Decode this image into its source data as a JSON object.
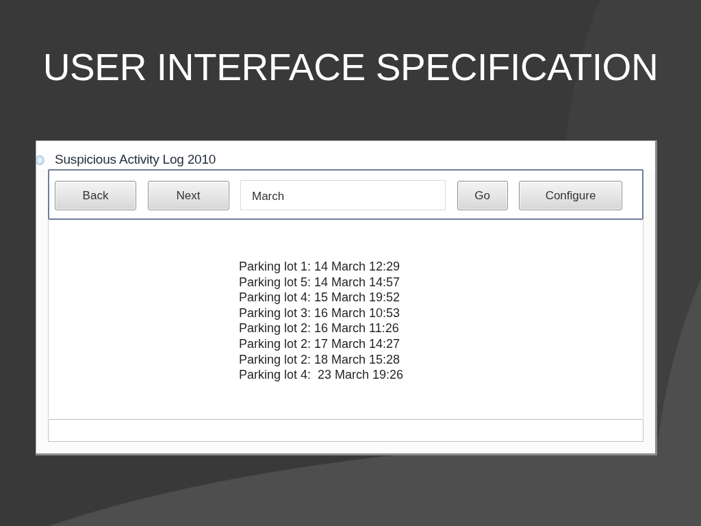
{
  "slide": {
    "title": "USER INTERFACE SPECIFICATION"
  },
  "window": {
    "title": "Suspicious Activity Log 2010"
  },
  "toolbar": {
    "items": [
      {
        "kind": "button",
        "label": "Back"
      },
      {
        "kind": "button",
        "label": "Next"
      },
      {
        "kind": "field",
        "value": "March"
      },
      {
        "kind": "button",
        "label": "Go"
      },
      {
        "kind": "button",
        "label": "Configure"
      }
    ]
  },
  "log_entries": [
    "Parking lot 1: 14 March 12:29",
    "Parking lot 5: 14 March 14:57",
    "Parking lot 4: 15 March 19:52",
    "Parking lot 3: 16 March 10:53",
    "Parking lot 2: 16 March 11:26",
    "Parking lot 2: 17 March 14:27",
    "Parking lot 2: 18 March 15:28",
    "Parking lot 4:  23 March 19:26"
  ]
}
